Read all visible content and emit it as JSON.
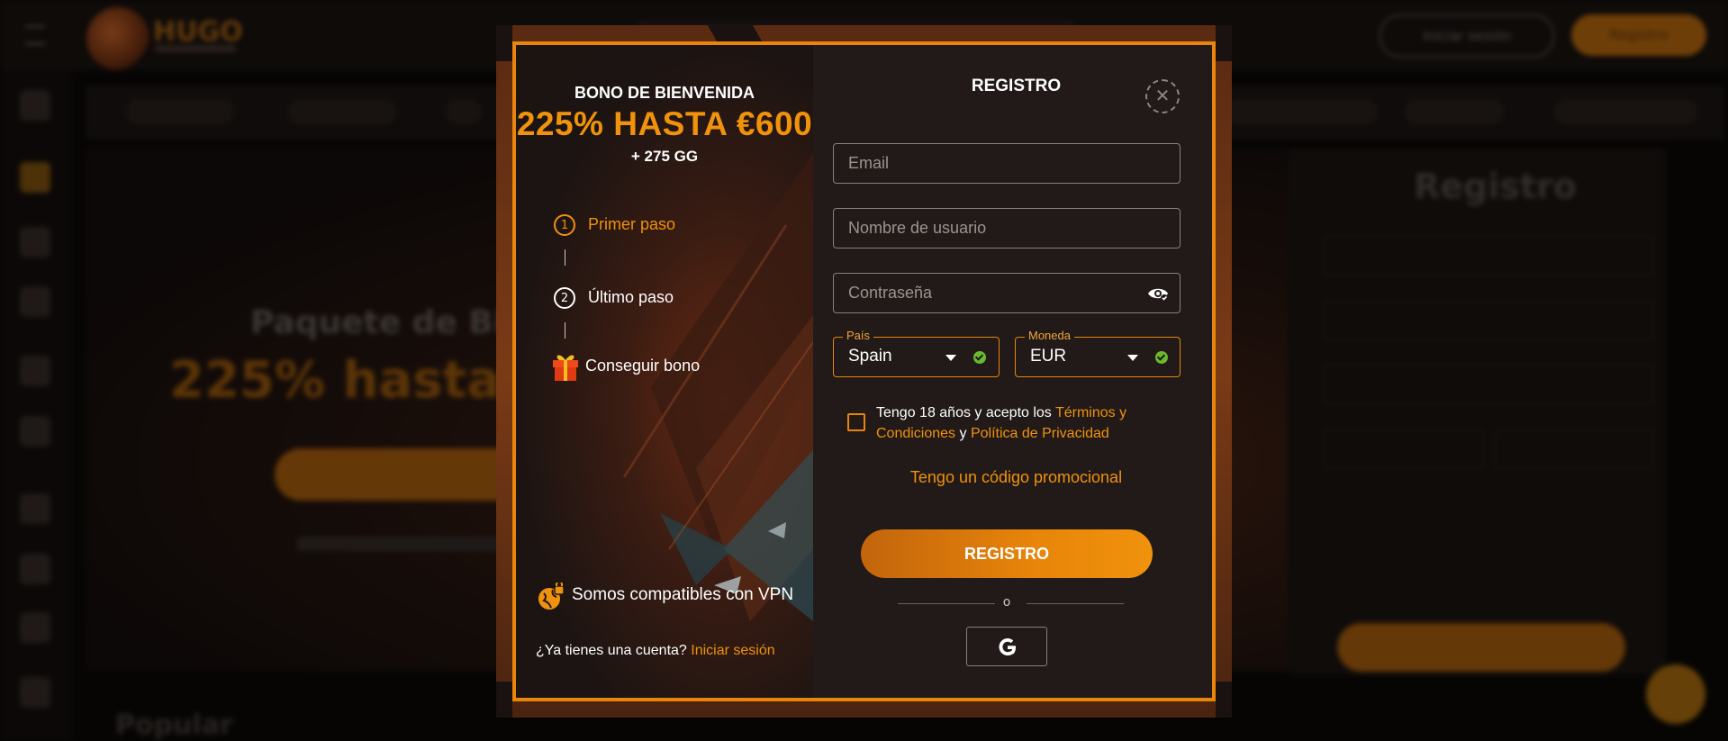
{
  "background": {
    "login_label": "Iniciar sesión",
    "register_label": "Registro",
    "hero_title": "Paquete de Bienvenida",
    "hero_bonus": "225% hasta €600",
    "form_title": "Registro",
    "popular_label": "Popular",
    "brand": "HUGO"
  },
  "modal": {
    "left": {
      "bonus_label": "BONO DE BIENVENIDA",
      "bonus_amount": "225% HASTA €600",
      "bonus_extra": "+ 275 GG",
      "steps": [
        {
          "number": "1",
          "label": "Primer paso",
          "state": "active"
        },
        {
          "number": "2",
          "label": "Último paso",
          "state": "next"
        },
        {
          "label": "Conseguir bono",
          "icon": "gift-icon"
        }
      ],
      "vpn_text": "Somos compatibles con VPN",
      "have_account": "¿Ya tienes una cuenta?",
      "login_link": "Iniciar sesión"
    },
    "right": {
      "title": "REGISTRO",
      "email_placeholder": "Email",
      "username_placeholder": "Nombre de usuario",
      "password_placeholder": "Contraseña",
      "country": {
        "label": "País",
        "value": "Spain"
      },
      "currency": {
        "label": "Moneda",
        "value": "EUR"
      },
      "terms": {
        "prefix": "Tengo 18 años y acepto los ",
        "terms_link": "Términos y Condiciones",
        "joiner": " y ",
        "privacy_link": "Política de Privacidad"
      },
      "promo_link": "Tengo un código promocional",
      "register_button": "REGISTRO",
      "or_text": "o",
      "google_icon": "google-icon"
    }
  },
  "colors": {
    "accent": "#f0920c",
    "frame_border": "#e8850a",
    "panel_bg": "#211a18",
    "valid": "#6ab82e"
  }
}
